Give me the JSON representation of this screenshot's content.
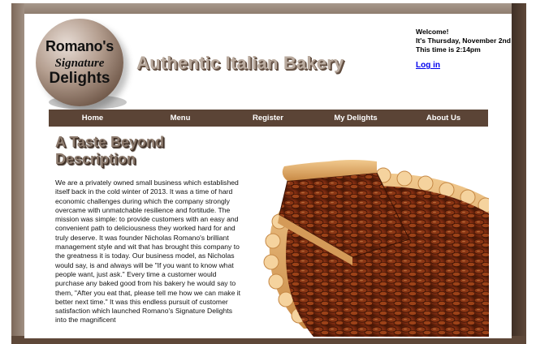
{
  "header": {
    "logo_line1": "Romano's",
    "logo_line2": "Signature",
    "logo_line3": "Delights",
    "tagline": "Authentic Italian Bakery",
    "welcome": "Welcome!",
    "date_line": "It's Thursday, November 2nd",
    "time_line": "This time is 2:14pm",
    "login_label": "Log in"
  },
  "nav": {
    "items": [
      {
        "label": "Home"
      },
      {
        "label": "Menu"
      },
      {
        "label": "Register"
      },
      {
        "label": "My Delights"
      },
      {
        "label": "About Us"
      }
    ]
  },
  "main": {
    "heading": "A Taste Beyond Description",
    "paragraph": "We are a privately owned small business which established itself back in the cold winter of 2013. It was a time of hard economic challenges during which the company strongly overcame with unmatchable resilience and fortitude. The mission was simple: to provide customers with an easy and convenient path to deliciousness they worked hard for and truly deserve. It was founder Nicholas Romano's brilliant management style and wit that has brought this company to the greatness it is today. Our business model, as Nicholas would say, is and always will be \"If you want to know what people want, just ask.\" Every time a customer would purchase any baked good from his bakery he would say to them, \"After you eat that, please tell me how we can make it better next time.\" It was this endless pursuit of customer satisfaction which launched Romano's Signature Delights into the magnificent",
    "image_alt": "pecan-pie"
  },
  "colors": {
    "frame": "#5e4839",
    "nav_bg": "#5b4436",
    "heading": "#8d7b6e",
    "link": "#0000ee"
  }
}
